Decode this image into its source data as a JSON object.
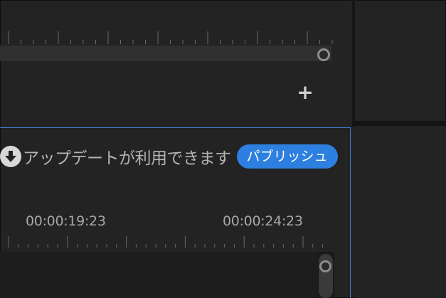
{
  "update_notice": {
    "text": "アップデートが利用できます",
    "publish_label": "パブリッシュ",
    "icon": "download-arrow-icon"
  },
  "timeline": {
    "timecodes": [
      "00:00:19:23",
      "00:00:24:23"
    ]
  },
  "toolbar": {
    "add_label": "+"
  },
  "colors": {
    "accent": "#2d7fe0",
    "focus_border": "#3d7fcf",
    "background": "#232323"
  }
}
